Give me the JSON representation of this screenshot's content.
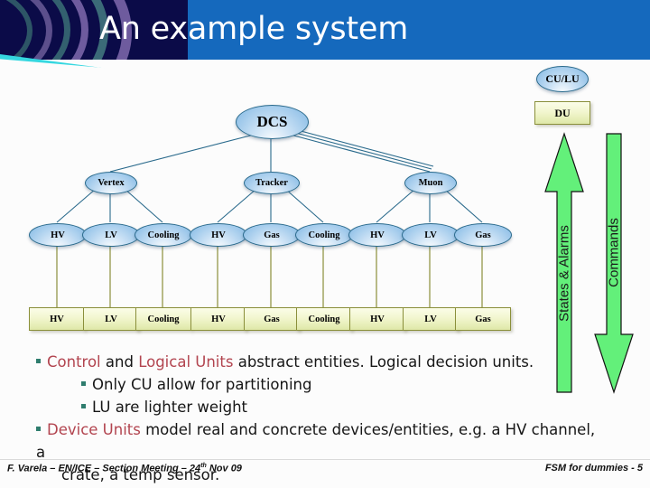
{
  "slide": {
    "title": "An example system",
    "page_label": "FSM for dummies - 5",
    "footer_left_prefix": "F. Varela – EN/ICE – Section Meeting – 24",
    "footer_left_sup": "th",
    "footer_left_suffix": " Nov 09"
  },
  "legend": {
    "cu_lu": "CU/LU",
    "du": "DU"
  },
  "diagram": {
    "root": "DCS",
    "groups": [
      {
        "name": "Vertex",
        "leaves": [
          "HV",
          "LV",
          "Cooling"
        ]
      },
      {
        "name": "Tracker",
        "leaves": [
          "HV",
          "Gas",
          "Cooling"
        ]
      },
      {
        "name": "Muon",
        "leaves": [
          "HV",
          "LV",
          "Gas"
        ]
      }
    ],
    "devices": [
      "HV",
      "LV",
      "Cooling",
      "HV",
      "Gas",
      "Cooling",
      "HV",
      "LV",
      "Gas"
    ]
  },
  "arrows": {
    "up_label": "States & Alarms",
    "down_label": "Commands",
    "color": "#63f07a"
  },
  "bullets": {
    "line1_a": "Control",
    "line1_b": " and ",
    "line1_c": "Logical Units",
    "line1_d": " abstract entities. Logical decision units.",
    "line2": "Only CU allow for partitioning",
    "line3": "LU are lighter weight",
    "line4_a": "Device Units",
    "line4_b": " model real and concrete devices/entities, e.g. a HV channel, a",
    "line4_cont": "crate, a temp sensor."
  },
  "colors": {
    "header_blue": "#1569bd",
    "header_dark": "#0b0b48",
    "highlight_red": "#b2444f",
    "bullet_square": "#2f7d6e",
    "node_fill": "#9cc7ea",
    "box_fill": "#dfe8a8"
  }
}
